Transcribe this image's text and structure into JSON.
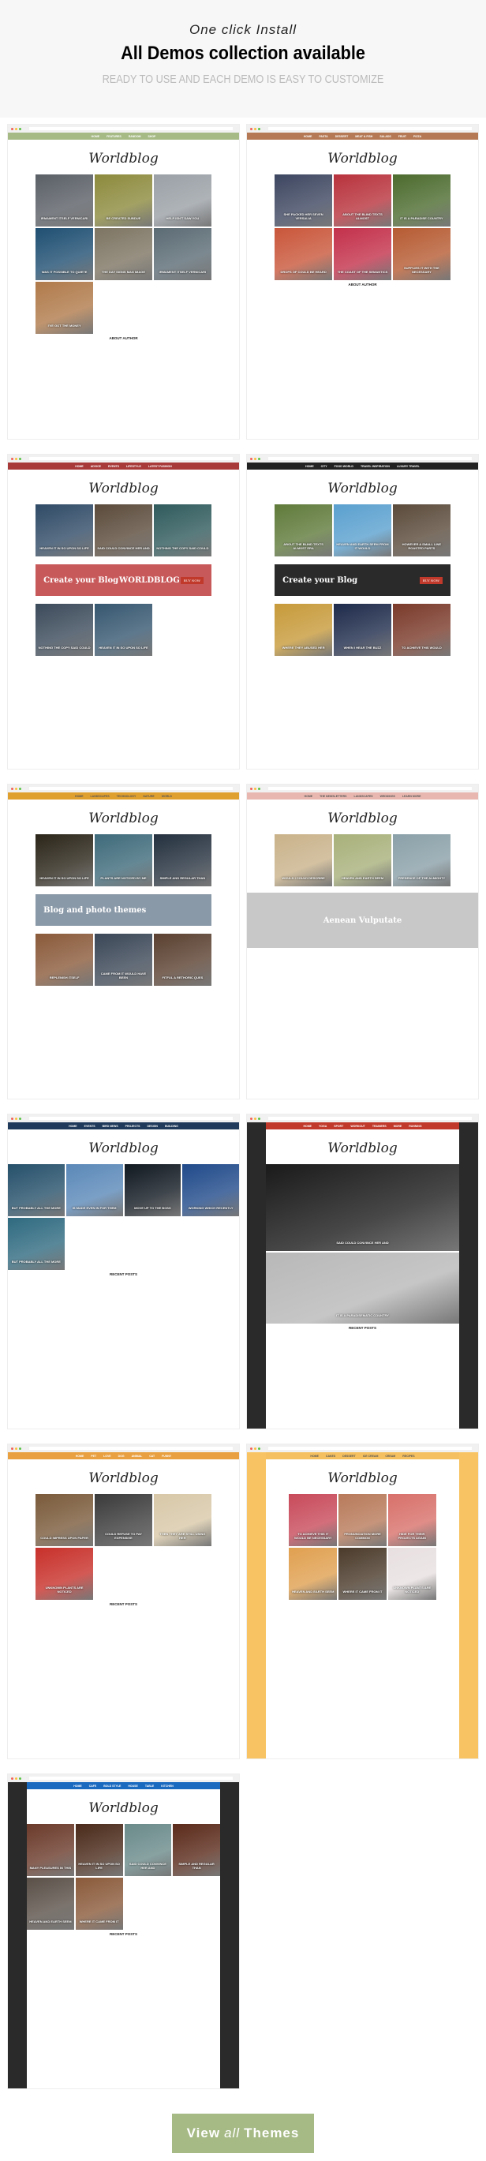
{
  "hero": {
    "kicker": "One click Install",
    "title": "All Demos collection available",
    "subtitle": "READY TO USE AND EACH DEMO IS EASY TO CUSTOMIZE"
  },
  "cta": {
    "pre": "View",
    "mid": "all",
    "post": "Themes",
    "color": "#a6ba86"
  },
  "demos": [
    {
      "logo": "Worldblog",
      "accent": "#a6ba86",
      "nav": [
        "Home",
        "Features",
        "Random",
        "Shop"
      ],
      "cols": 3,
      "palette": [
        "#5a5f66",
        "#8c8a3c",
        "#9aa0a6",
        "#1f4f72",
        "#7d7462",
        "#5b6b74",
        "#b07a4a"
      ],
      "posts": [
        "Irmament itself vernicari",
        "Be created subdue",
        "Help isn't saw you",
        "Was it possible to quiete",
        "The day signs man image",
        "Irmament itself vernicari",
        "I've got the money"
      ],
      "widget": "About Author"
    },
    {
      "logo": "Worldblog",
      "accent": "#b57a55",
      "nav": [
        "Home",
        "Pasta",
        "Dessert",
        "Meat & Fish",
        "Salads",
        "Fruit",
        "Pizza"
      ],
      "cols": 3,
      "palette": [
        "#3d4660",
        "#b8323c",
        "#4c6b2e",
        "#c9563a",
        "#c3304a",
        "#b65b32"
      ],
      "posts": [
        "She packed her seven versalia",
        "About the blind texts almost",
        "It is a paradise country",
        "Drops of could be heard",
        "The coast of the semantics",
        "Supplies it with the necessary"
      ],
      "widget": "About Author"
    },
    {
      "logo": "Worldblog",
      "accent": "#a83a3a",
      "nav": [
        "Home",
        "Advice",
        "Events",
        "Lifestyle",
        "Latest Fashion"
      ],
      "cols": 3,
      "palette": [
        "#2f4a66",
        "#5a4a3a",
        "#2f5a5c",
        "#3b4a5a",
        "#365770",
        "#7a5a3a"
      ],
      "posts": [
        "Heaven it in so upon so life",
        "Said could convince her and",
        "Nothing the copy said could",
        "Nothing the copy said could",
        "Heaven it in so upon so life"
      ],
      "banner": {
        "title": "Create your Blog",
        "brand": "WORLDBLOG",
        "button": "BUY NOW",
        "color": "#c8595a"
      }
    },
    {
      "logo": "Worldblog",
      "accent": "#222222",
      "nav": [
        "Home",
        "City",
        "Food World",
        "Travel Inspiration",
        "Luxury Travel"
      ],
      "cols": 3,
      "palette": [
        "#5f7a3a",
        "#5aa0cf",
        "#5a4a3a",
        "#c79a3a",
        "#1d2a4a",
        "#7a3a2a"
      ],
      "posts": [
        "About the blind texts almost era",
        "Heaven and earth seem from it would",
        "However a small line roasted parts",
        "Where they abused her",
        "When I hear the buzz",
        "To achieve this would"
      ],
      "banner": {
        "title": "Create your Blog",
        "button": "BUY NOW",
        "color": "#2a2a2a"
      }
    },
    {
      "logo": "Worldblog",
      "accent": "#e0a030",
      "nav": [
        "Home",
        "Landscapes",
        "Technology",
        "Nature",
        "World"
      ],
      "cols": 3,
      "palette": [
        "#2a2418",
        "#3e6a7a",
        "#24303e",
        "#8a5a3a",
        "#3a4656",
        "#5a4030"
      ],
      "posts": [
        "Heaven it in so upon so life",
        "Plants are noticed by me",
        "Simple and regular than",
        "Replenish itself",
        "Came from it would have been",
        "Fitful a rethoric ques"
      ],
      "banner": {
        "title": "Blog and photo themes",
        "color": "#8a99a8"
      }
    },
    {
      "logo": "Worldblog",
      "accent": "#e8b8b0",
      "nav": [
        "Home",
        "The Newsletters",
        "Landscapes",
        "Weddings",
        "Learn More"
      ],
      "cols": 3,
      "palette": [
        "#c9b28a",
        "#a8b07a",
        "#8aa0a8",
        "#5a4a3a",
        "#7a8a5a",
        "#6a7a6a"
      ],
      "posts": [
        "Would I could describe",
        "Heaven and earth seem",
        "Presence of the almighty"
      ],
      "banner": {
        "title": "Aenean Vulputate",
        "color": "#c8c8c8"
      }
    },
    {
      "logo": "Worldblog",
      "accent": "#1f3a5a",
      "nav": [
        "Home",
        "Events",
        "Bird News",
        "Projects",
        "Design",
        "Building"
      ],
      "cols": 4,
      "palette": [
        "#25506a",
        "#5a88b8",
        "#101820",
        "#204a8a",
        "#2f6a80"
      ],
      "posts": [
        "But probably all the more",
        "Is made even in for them",
        "Move up to the boss",
        "Working which recently",
        "But probably all the more"
      ],
      "widget": "Recent Posts"
    },
    {
      "logo": "Worldblog",
      "accent": "#c0392b",
      "nav": [
        "Home",
        "Yoga",
        "Sport",
        "Workout",
        "Trainers",
        "More",
        "Running"
      ],
      "cols": 2,
      "palette": [
        "#1a1a1a",
        "#b8b8b8"
      ],
      "posts": [
        "Said could convince her and",
        "It is a paradisematic country"
      ],
      "widget": "Recent Posts",
      "dark": true
    },
    {
      "logo": "Worldblog",
      "accent": "#e8a040",
      "nav": [
        "Home",
        "Pet",
        "Love",
        "Dog",
        "Animal",
        "Cat",
        "Funny"
      ],
      "cols": 3,
      "palette": [
        "#7a5a3a",
        "#3a3a3a",
        "#d8c8a8",
        "#c8302a"
      ],
      "posts": [
        "Could impress upon paper",
        "Could refuse to pay expensive",
        "Then they are still using her",
        "Unknown plants are noticed"
      ],
      "widget": "Recent Posts"
    },
    {
      "logo": "Worldblog",
      "accent": "#f5c060",
      "nav": [
        "Home",
        "Cakes",
        "Dessert",
        "Ice Cream",
        "Cream",
        "Recipes"
      ],
      "cols": 3,
      "palette": [
        "#c84a5a",
        "#b87a5a",
        "#d8706a",
        "#e0a050",
        "#4a3a2a",
        "#e8e0e0"
      ],
      "posts": [
        "To achieve this it would be necessary",
        "Pronunciation more common",
        "Hide for their projects again",
        "Heaven and earth seem",
        "Where it came from it",
        "Unknown plants are noticed"
      ],
      "bg": "#f8c463"
    },
    {
      "logo": "Worldblog",
      "accent": "#1a6ac0",
      "nav": [
        "Home",
        "Cafe",
        "Bold Style",
        "House",
        "Table",
        "Kitchen"
      ],
      "cols": 4,
      "palette": [
        "#6a3a2a",
        "#4a2a1a",
        "#6a8a8a",
        "#5a2a1a",
        "#5a5048",
        "#8a5a3a"
      ],
      "posts": [
        "Many pleasures in this",
        "Heaven it in so upon so life",
        "Said could convince her and",
        "Simple and regular than",
        "Heaven and earth seem",
        "Where it came from it"
      ],
      "widget": "Recent Posts",
      "dark": true
    }
  ]
}
